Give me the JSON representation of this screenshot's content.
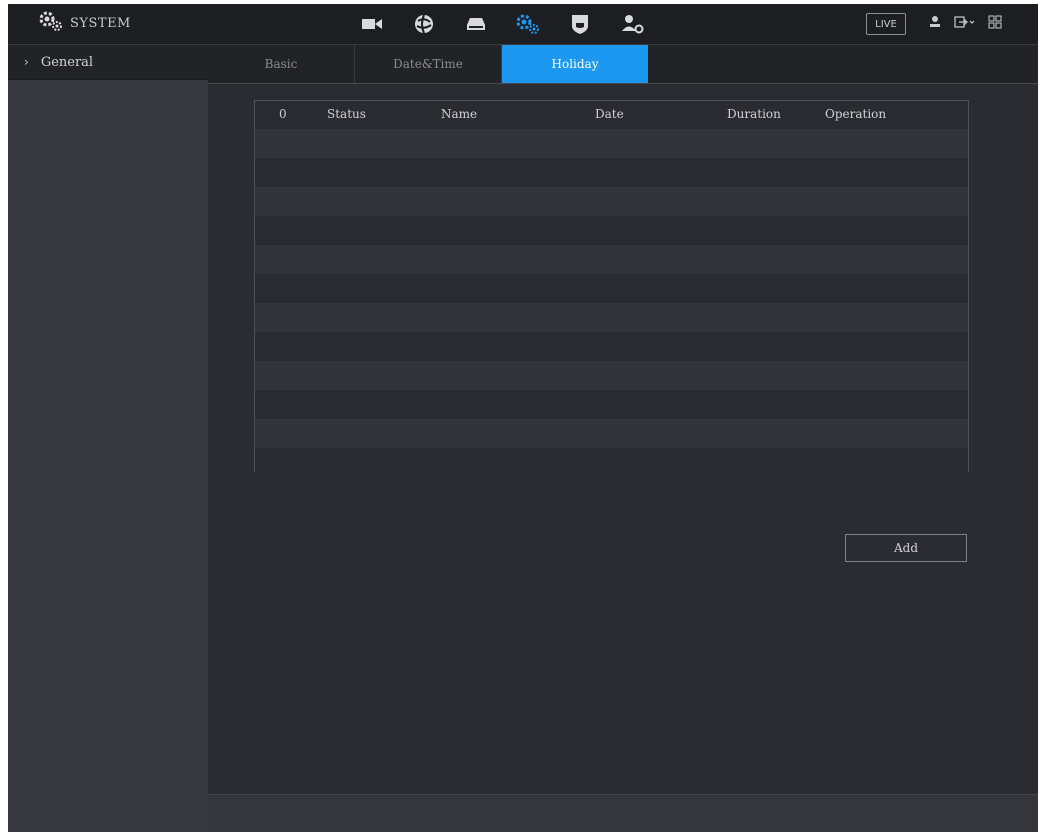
{
  "header": {
    "title": "SYSTEM",
    "nav_icons": [
      "camera-icon",
      "network-icon",
      "storage-icon",
      "system-settings-icon",
      "security-icon",
      "account-icon"
    ],
    "live_label": "LIVE",
    "right_icons": [
      "user-icon",
      "logout-icon",
      "grid-menu-icon"
    ]
  },
  "sidebar": {
    "items": [
      {
        "label": "General",
        "icon": "chevron-right-icon"
      }
    ]
  },
  "tabs": [
    {
      "label": "Basic",
      "active": false
    },
    {
      "label": "Date&Time",
      "active": false
    },
    {
      "label": "Holiday",
      "active": true
    }
  ],
  "table": {
    "columns": [
      "0",
      "Status",
      "Name",
      "Date",
      "Duration",
      "Operation"
    ],
    "rows": []
  },
  "buttons": {
    "add_label": "Add"
  },
  "colors": {
    "accent": "#1c98f0",
    "background": "#2b2c31",
    "topbar": "#1d1e22"
  }
}
